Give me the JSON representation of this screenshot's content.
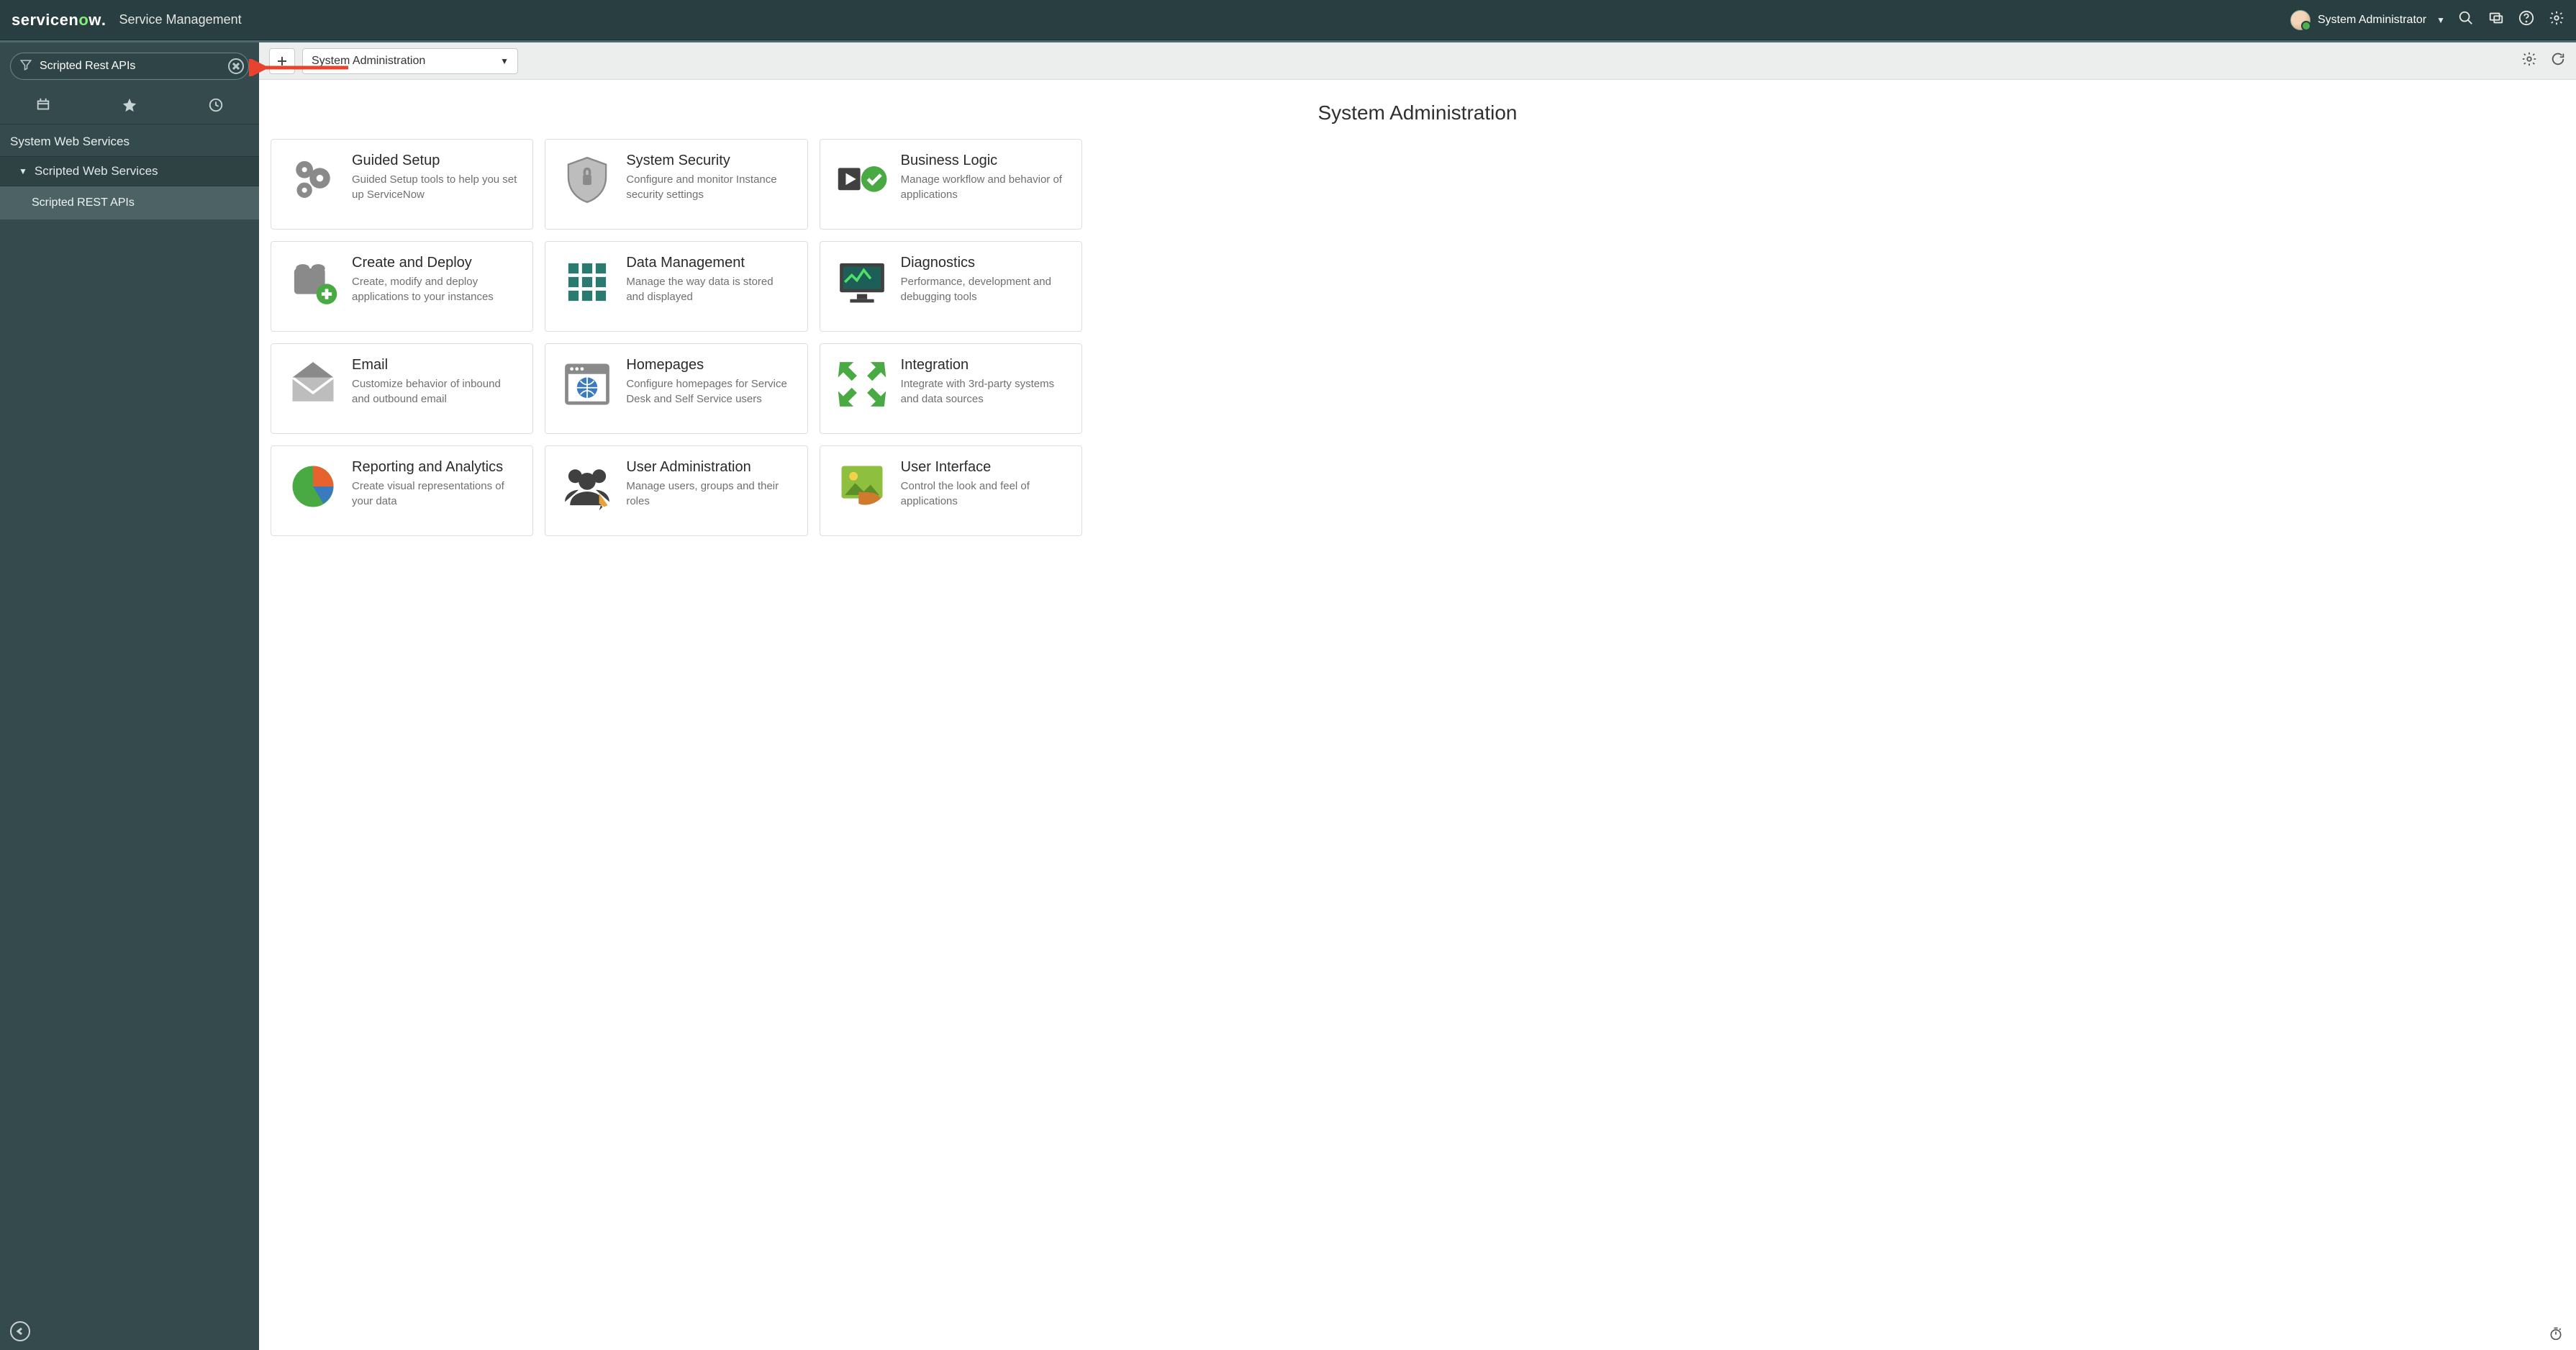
{
  "header": {
    "logo_text_a": "service",
    "logo_text_b": "n",
    "logo_text_c": "o",
    "logo_text_d": "w",
    "subtitle": "Service Management",
    "user_name": "System Administrator"
  },
  "sidebar": {
    "filter_value": "Scripted Rest APIs",
    "app_title": "System Web Services",
    "module_group": "Scripted Web Services",
    "module_item": "Scripted REST APIs"
  },
  "toolbar": {
    "selector_label": "System Administration"
  },
  "page": {
    "title": "System Administration"
  },
  "cards": [
    {
      "title": "Guided Setup",
      "desc": "Guided Setup tools to help you set up ServiceNow",
      "icon": "gears"
    },
    {
      "title": "System Security",
      "desc": "Configure and monitor Instance security settings",
      "icon": "shield"
    },
    {
      "title": "Business Logic",
      "desc": "Manage workflow and behavior of applications",
      "icon": "playcheck"
    },
    {
      "title": "Create and Deploy",
      "desc": "Create, modify and deploy applications to your instances",
      "icon": "blocksplus"
    },
    {
      "title": "Data Management",
      "desc": "Manage the way data is stored and displayed",
      "icon": "grid9"
    },
    {
      "title": "Diagnostics",
      "desc": "Performance, development and debugging tools",
      "icon": "monitor"
    },
    {
      "title": "Email",
      "desc": "Customize behavior of inbound and outbound email",
      "icon": "envelope"
    },
    {
      "title": "Homepages",
      "desc": "Configure homepages for Service Desk and Self Service users",
      "icon": "browserglobe"
    },
    {
      "title": "Integration",
      "desc": "Integrate with 3rd-party systems and data sources",
      "icon": "arrowsin"
    },
    {
      "title": "Reporting and Analytics",
      "desc": "Create visual representations of your data",
      "icon": "pie"
    },
    {
      "title": "User Administration",
      "desc": "Manage users, groups and their roles",
      "icon": "users"
    },
    {
      "title": "User Interface",
      "desc": "Control the look and feel of applications",
      "icon": "picture"
    }
  ]
}
